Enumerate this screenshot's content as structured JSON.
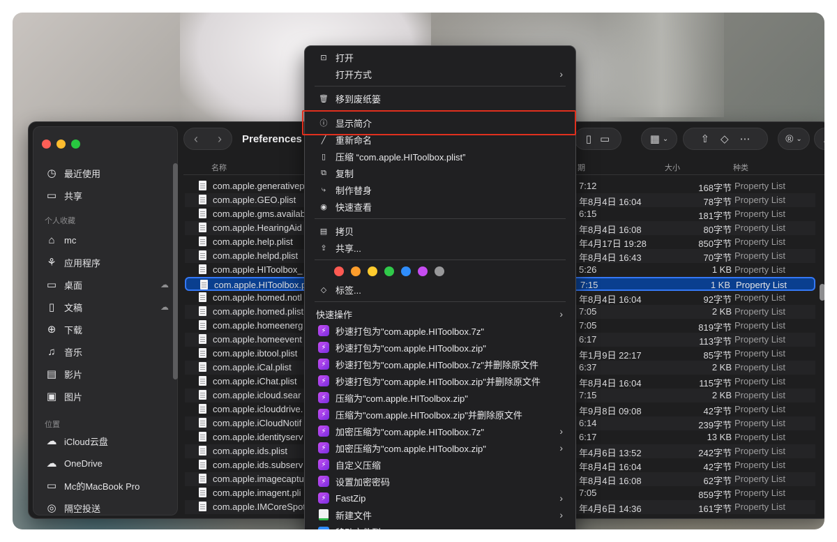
{
  "finder": {
    "title": "Preferences",
    "columns": {
      "name": "名称",
      "date": "期",
      "size": "大小",
      "kind": "种类"
    },
    "sidebar": {
      "items_top": [
        {
          "label": "最近使用",
          "icon": "clock-icon"
        },
        {
          "label": "共享",
          "icon": "shared-folder-icon"
        }
      ],
      "favorites_header": "个人收藏",
      "favorites": [
        {
          "label": "mc",
          "icon": "home-icon"
        },
        {
          "label": "应用程序",
          "icon": "applications-icon"
        },
        {
          "label": "桌面",
          "icon": "desktop-icon"
        },
        {
          "label": "文稿",
          "icon": "document-icon"
        },
        {
          "label": "下载",
          "icon": "download-icon"
        },
        {
          "label": "音乐",
          "icon": "music-icon"
        },
        {
          "label": "影片",
          "icon": "film-icon"
        },
        {
          "label": "图片",
          "icon": "photo-icon"
        }
      ],
      "locations_header": "位置",
      "locations": [
        {
          "label": "iCloud云盘",
          "icon": "cloud-icon"
        },
        {
          "label": "OneDrive",
          "icon": "onedrive-icon"
        },
        {
          "label": "Mc的MacBook Pro",
          "icon": "laptop-icon"
        },
        {
          "label": "隔空投送",
          "icon": "airdrop-icon"
        }
      ]
    },
    "files": [
      {
        "name": "com.apple.generativep",
        "date": "7:12",
        "size": "168字节",
        "kind": "Property List"
      },
      {
        "name": "com.apple.GEO.plist",
        "date": "年8月4日 16:04",
        "size": "78字节",
        "kind": "Property List"
      },
      {
        "name": "com.apple.gms.availab",
        "date": "6:15",
        "size": "181字节",
        "kind": "Property List"
      },
      {
        "name": "com.apple.HearingAid",
        "date": "年8月4日 16:08",
        "size": "80字节",
        "kind": "Property List"
      },
      {
        "name": "com.apple.help.plist",
        "date": "年4月17日 19:28",
        "size": "850字节",
        "kind": "Property List"
      },
      {
        "name": "com.apple.helpd.plist",
        "date": "年8月4日 16:43",
        "size": "70字节",
        "kind": "Property List"
      },
      {
        "name": "com.apple.HIToolbox_",
        "date": "5:26",
        "size": "1 KB",
        "kind": "Property List"
      },
      {
        "name": "com.apple.HIToolbox.p",
        "date": "7:15",
        "size": "1 KB",
        "kind": "Property List",
        "selected": true
      },
      {
        "name": "com.apple.homed.notl",
        "date": "年8月4日 16:04",
        "size": "92字节",
        "kind": "Property List"
      },
      {
        "name": "com.apple.homed.plist",
        "date": "7:05",
        "size": "2 KB",
        "kind": "Property List"
      },
      {
        "name": "com.apple.homeenerg",
        "date": "7:05",
        "size": "819字节",
        "kind": "Property List"
      },
      {
        "name": "com.apple.homeevent",
        "date": "6:17",
        "size": "113字节",
        "kind": "Property List"
      },
      {
        "name": "com.apple.ibtool.plist",
        "date": "年1月9日 22:17",
        "size": "85字节",
        "kind": "Property List"
      },
      {
        "name": "com.apple.iCal.plist",
        "date": "6:37",
        "size": "2 KB",
        "kind": "Property List"
      },
      {
        "name": "com.apple.iChat.plist",
        "date": "年8月4日 16:04",
        "size": "115字节",
        "kind": "Property List"
      },
      {
        "name": "com.apple.icloud.sear",
        "date": "7:15",
        "size": "2 KB",
        "kind": "Property List"
      },
      {
        "name": "com.apple.iclouddrive.",
        "date": "年9月8日 09:08",
        "size": "42字节",
        "kind": "Property List"
      },
      {
        "name": "com.apple.iCloudNotif",
        "date": "6:14",
        "size": "239字节",
        "kind": "Property List"
      },
      {
        "name": "com.apple.identityserv",
        "date": "6:17",
        "size": "13 KB",
        "kind": "Property List"
      },
      {
        "name": "com.apple.ids.plist",
        "date": "年4月6日 13:52",
        "size": "242字节",
        "kind": "Property List"
      },
      {
        "name": "com.apple.ids.subserv",
        "date": "年8月4日 16:04",
        "size": "42字节",
        "kind": "Property List"
      },
      {
        "name": "com.apple.imagecaptu",
        "date": "年8月4日 16:08",
        "size": "62字节",
        "kind": "Property List"
      },
      {
        "name": "com.apple.imagent.pli",
        "date": "7:05",
        "size": "859字节",
        "kind": "Property List"
      },
      {
        "name": "com.apple.IMCoreSpot",
        "date": "年4月6日 14:36",
        "size": "161字节",
        "kind": "Property List"
      }
    ]
  },
  "menu": {
    "items_top": [
      {
        "label": "打开",
        "icon": "open-icon"
      },
      {
        "label": "打开方式",
        "icon": "",
        "submenu": true
      }
    ],
    "trash": {
      "label": "移到废纸篓",
      "icon": "trash-icon"
    },
    "info": {
      "label": "显示简介",
      "icon": "info-icon"
    },
    "items_mid": [
      {
        "label": "重新命名",
        "icon": "pencil-icon"
      },
      {
        "label": "压缩 “com.apple.HIToolbox.plist”",
        "icon": "zip-icon"
      },
      {
        "label": "复制",
        "icon": "duplicate-icon"
      },
      {
        "label": "制作替身",
        "icon": "alias-icon"
      },
      {
        "label": "快速查看",
        "icon": "eye-icon"
      }
    ],
    "items_copy": [
      {
        "label": "拷贝",
        "icon": "copy-icon"
      },
      {
        "label": "共享...",
        "icon": "share-icon"
      }
    ],
    "tag_colors": [
      "#fe5a52",
      "#fd9d2c",
      "#fecb2e",
      "#30c94a",
      "#2f8dfb",
      "#c64cf1",
      "#98989a"
    ],
    "tags_label": "标签...",
    "quick_actions_label": "快速操作",
    "actions": [
      {
        "label": "秒速打包为\"com.apple.HIToolbox.7z\"",
        "icon": "purple-app-icon"
      },
      {
        "label": "秒速打包为\"com.apple.HIToolbox.zip\"",
        "icon": "purple-app-icon"
      },
      {
        "label": "秒速打包为\"com.apple.HIToolbox.7z\"并删除原文件",
        "icon": "purple-app-icon"
      },
      {
        "label": "秒速打包为\"com.apple.HIToolbox.zip\"并删除原文件",
        "icon": "purple-app-icon"
      },
      {
        "label": "压缩为\"com.apple.HIToolbox.zip\"",
        "icon": "purple-app-icon"
      },
      {
        "label": "压缩为\"com.apple.HIToolbox.zip\"并删除原文件",
        "icon": "purple-app-icon"
      },
      {
        "label": "加密压缩为\"com.apple.HIToolbox.7z\"",
        "icon": "purple-app-icon",
        "submenu": true
      },
      {
        "label": "加密压缩为\"com.apple.HIToolbox.zip\"",
        "icon": "purple-app-icon",
        "submenu": true
      },
      {
        "label": "自定义压缩",
        "icon": "purple-app-icon"
      },
      {
        "label": "设置加密密码",
        "icon": "purple-app-icon"
      },
      {
        "label": "FastZip",
        "icon": "purple-app-icon",
        "submenu": true
      },
      {
        "label": "新建文件",
        "icon": "new-file-icon",
        "submenu": true
      },
      {
        "label": "移动文件到...",
        "icon": "move-file-icon",
        "submenu": true
      }
    ]
  },
  "colors": {
    "highlight": "#e0301e",
    "selection": "#3478f6"
  }
}
